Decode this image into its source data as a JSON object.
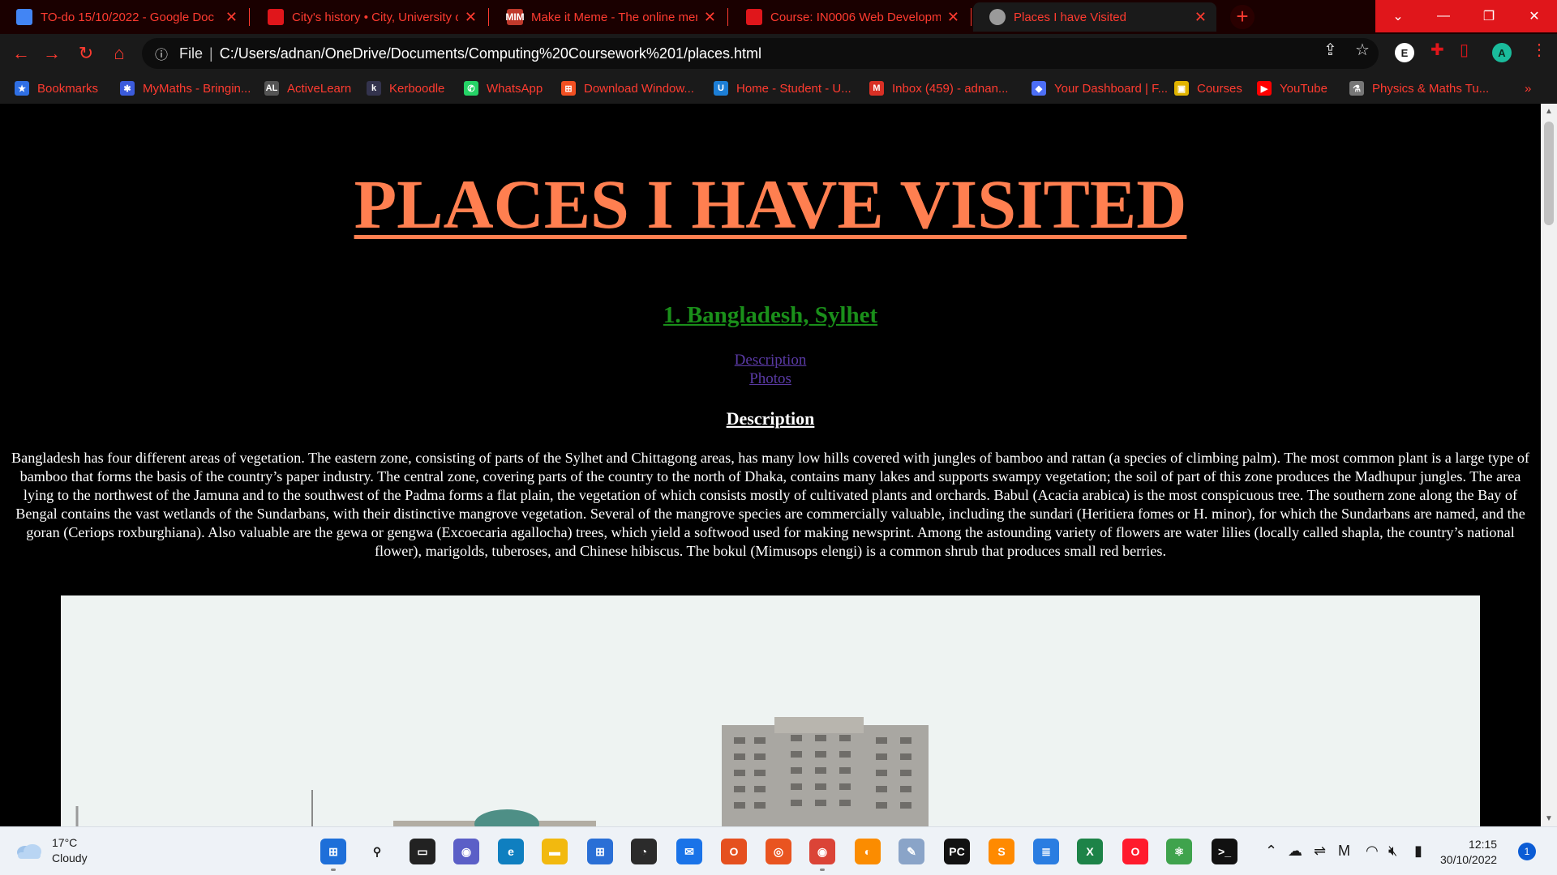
{
  "browser": {
    "tabs": [
      {
        "label": "TO-do 15/10/2022 - Google Doc",
        "icon": "google-docs-icon",
        "color": "#4285f4"
      },
      {
        "label": "City's history • City, University of",
        "icon": "city-university-icon",
        "color": "#e0161b"
      },
      {
        "label": "Make it Meme - The online mem",
        "icon": "make-it-meme-icon",
        "icon_text": "MIM",
        "color": "#c0392b"
      },
      {
        "label": "Course: IN0006 Web Developme",
        "icon": "moodle-course-icon",
        "color": "#e0161b"
      },
      {
        "label": "Places I have Visited",
        "icon": "globe-icon",
        "color": "#9a9a9a"
      }
    ],
    "window_controls": {
      "minimize": "—",
      "restore": "❐",
      "close": "✕",
      "dropdown": "⌄"
    },
    "address": {
      "scheme": "File",
      "url": "C:/Users/adnan/OneDrive/Documents/Computing%20Coursework%201/places.html"
    },
    "extensions": [
      {
        "label": "E",
        "color": "#ffffff",
        "bg": "#1a1a1a"
      },
      {
        "label": "A",
        "color": "#0b2b1f",
        "bg": "#1abc9c"
      }
    ],
    "bookmarks": [
      {
        "label": "Bookmarks",
        "icon": "star-icon",
        "icon_text": "★",
        "color": "#2f6fe4"
      },
      {
        "label": "MyMaths - Bringin...",
        "icon": "mymaths-icon",
        "icon_text": "✱",
        "color": "#3b5bdb"
      },
      {
        "label": "ActiveLearn",
        "icon": "activelearn-icon",
        "icon_text": "AL",
        "color": "#555555"
      },
      {
        "label": "Kerboodle",
        "icon": "kerboodle-icon",
        "icon_text": "k",
        "color": "#33334d"
      },
      {
        "label": "WhatsApp",
        "icon": "whatsapp-icon",
        "icon_text": "✆",
        "color": "#25d366"
      },
      {
        "label": "Download Window...",
        "icon": "windows-icon",
        "icon_text": "⊞",
        "color": "#f25022"
      },
      {
        "label": "Home - Student - U...",
        "icon": "unifrog-icon",
        "icon_text": "U",
        "color": "#1c7ed6"
      },
      {
        "label": "Inbox (459) - adnan...",
        "icon": "gmail-icon",
        "icon_text": "M",
        "color": "#d93025"
      },
      {
        "label": "Your Dashboard | F...",
        "icon": "dashboard-icon",
        "icon_text": "◆",
        "color": "#4c6ef5"
      },
      {
        "label": "Courses",
        "icon": "courses-icon",
        "icon_text": "▣",
        "color": "#e0b400"
      },
      {
        "label": "YouTube",
        "icon": "youtube-icon",
        "icon_text": "▶",
        "color": "#ff0000"
      },
      {
        "label": "Physics & Maths Tu...",
        "icon": "pmt-icon",
        "icon_text": "⚗",
        "color": "#777777"
      }
    ],
    "bookmarks_overflow": "»"
  },
  "page": {
    "title": "PLACES I HAVE VISITED",
    "place_heading": "1. Bangladesh, Sylhet",
    "links": {
      "description": "Description",
      "photos": "Photos"
    },
    "description_heading": "Description",
    "description_text": "Bangladesh has four different areas of vegetation. The eastern zone, consisting of parts of the Sylhet and Chittagong areas, has many low hills covered with jungles of bamboo and rattan (a species of climbing palm). The most common plant is a large type of bamboo that forms the basis of the country’s paper industry. The central zone, covering parts of the country to the north of Dhaka, contains many lakes and supports swampy vegetation; the soil of part of this zone produces the Madhupur jungles. The area lying to the northwest of the Jamuna and to the southwest of the Padma forms a flat plain, the vegetation of which consists mostly of cultivated plants and orchards. Babul (Acacia arabica) is the most conspicuous tree. The southern zone along the Bay of Bengal contains the vast wetlands of the Sundarbans, with their distinctive mangrove vegetation. Several of the mangrove species are commercially valuable, including the sundari (Heritiera fomes or H. minor), for which the Sundarbans are named, and the goran (Ceriops roxburghiana). Also valuable are the gewa or gengwa (Excoecaria agallocha) trees, which yield a softwood used for making newsprint. Among the astounding variety of flowers are water lilies (locally called shapla, the country’s national flower), marigolds, tuberoses, and Chinese hibiscus. The bokul (Mimusops elengi) is a common shrub that produces small red berries."
  },
  "colors": {
    "title": "#ff7f50",
    "place_heading": "#1a8f1a",
    "links": "#5a3aa5",
    "browser_accent": "#ff3b30"
  },
  "taskbar": {
    "weather": {
      "temperature": "17°C",
      "condition": "Cloudy"
    },
    "apps": [
      {
        "name": "start-button-icon",
        "glyph": "⊞",
        "bg": "#1e6fd9"
      },
      {
        "name": "search-icon",
        "glyph": "⚲",
        "bg": "transparent"
      },
      {
        "name": "task-view-icon",
        "glyph": "▭",
        "bg": "#222222"
      },
      {
        "name": "teams-chat-icon",
        "glyph": "◉",
        "bg": "#5b5fc7"
      },
      {
        "name": "edge-icon",
        "glyph": "e",
        "bg": "#0f7fc0"
      },
      {
        "name": "file-explorer-icon",
        "glyph": "▬",
        "bg": "#f2b90f"
      },
      {
        "name": "microsoft-store-icon",
        "glyph": "⊞",
        "bg": "#2a6fd6"
      },
      {
        "name": "speedometer-icon",
        "glyph": "◔",
        "bg": "#2b2b2b"
      },
      {
        "name": "mail-icon",
        "glyph": "✉",
        "bg": "#1a73e8"
      },
      {
        "name": "office-icon",
        "glyph": "O",
        "bg": "#e5501f"
      },
      {
        "name": "ubuntu-icon",
        "glyph": "◎",
        "bg": "#e95420"
      },
      {
        "name": "chrome-icon",
        "glyph": "◉",
        "bg": "#db4437"
      },
      {
        "name": "brave-icon",
        "glyph": "◐",
        "bg": "#fb8c00"
      },
      {
        "name": "notepad-icon",
        "glyph": "✎",
        "bg": "#8aa4c8"
      },
      {
        "name": "pycharm-icon",
        "glyph": "PC",
        "bg": "#111111"
      },
      {
        "name": "sublime-text-icon",
        "glyph": "S",
        "bg": "#ff8a00"
      },
      {
        "name": "notes-icon",
        "glyph": "≣",
        "bg": "#2a7de1"
      },
      {
        "name": "excel-icon",
        "glyph": "X",
        "bg": "#1d8348"
      },
      {
        "name": "opera-icon",
        "glyph": "O",
        "bg": "#ff1b2d"
      },
      {
        "name": "atom-icon",
        "glyph": "⚛",
        "bg": "#3fa34d"
      },
      {
        "name": "terminal-icon",
        "glyph": ">_",
        "bg": "#111111"
      }
    ],
    "clock": {
      "time": "12:15",
      "date": "30/10/2022"
    },
    "notifications": "1"
  }
}
